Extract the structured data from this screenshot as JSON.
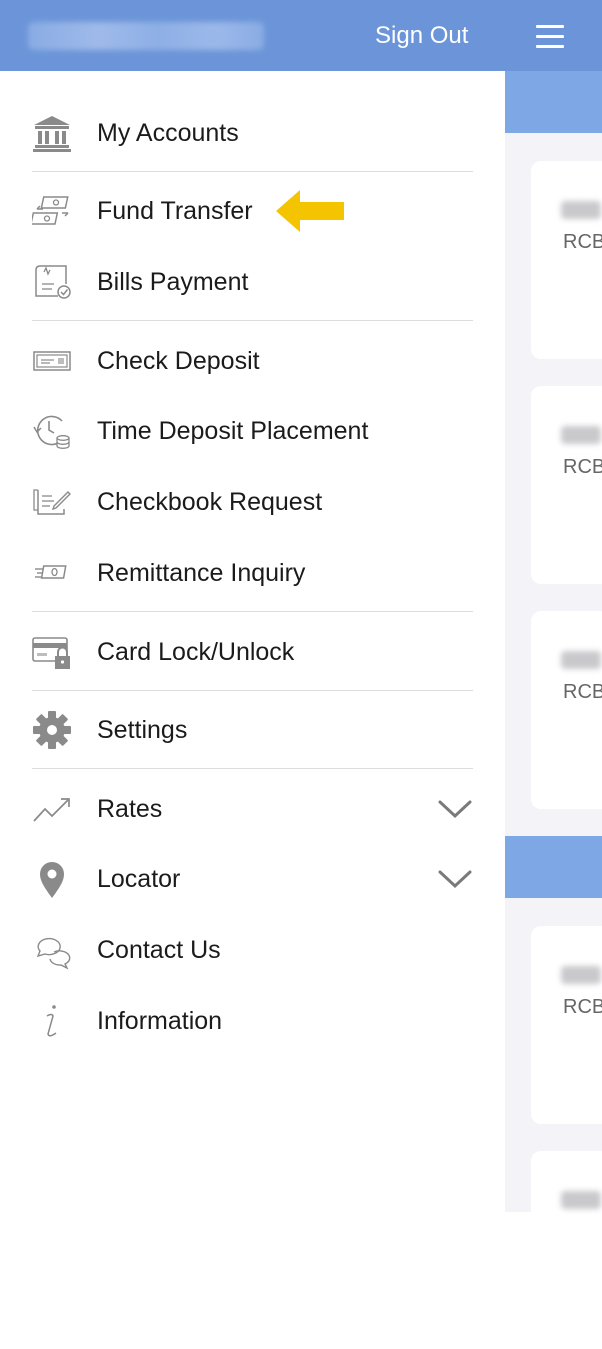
{
  "header": {
    "sign_out": "Sign Out",
    "bar_color": "#6b95d8"
  },
  "menu": {
    "items": [
      {
        "label": "My Accounts",
        "icon": "bank-icon"
      },
      {
        "label": "Fund Transfer",
        "icon": "fund-transfer-icon"
      },
      {
        "label": "Bills Payment",
        "icon": "bills-payment-icon"
      },
      {
        "label": "Check Deposit",
        "icon": "check-deposit-icon"
      },
      {
        "label": "Time Deposit Placement",
        "icon": "time-deposit-icon"
      },
      {
        "label": "Checkbook Request",
        "icon": "checkbook-icon"
      },
      {
        "label": "Remittance Inquiry",
        "icon": "remittance-icon"
      },
      {
        "label": "Card Lock/Unlock",
        "icon": "card-lock-icon"
      },
      {
        "label": "Settings",
        "icon": "gear-icon"
      },
      {
        "label": "Rates",
        "icon": "trend-up-icon",
        "expandable": true
      },
      {
        "label": "Locator",
        "icon": "map-pin-icon",
        "expandable": true
      },
      {
        "label": "Contact Us",
        "icon": "chat-bubbles-icon"
      },
      {
        "label": "Information",
        "icon": "info-icon"
      }
    ]
  },
  "background": {
    "cards": [
      {
        "code": "RCB"
      },
      {
        "code": "RCB"
      },
      {
        "code": "RCB"
      },
      {
        "code": "RCB"
      }
    ],
    "band_color": "#7ea7e6"
  },
  "annotation": {
    "arrow_color": "#f5c400",
    "points_to": "Fund Transfer"
  }
}
